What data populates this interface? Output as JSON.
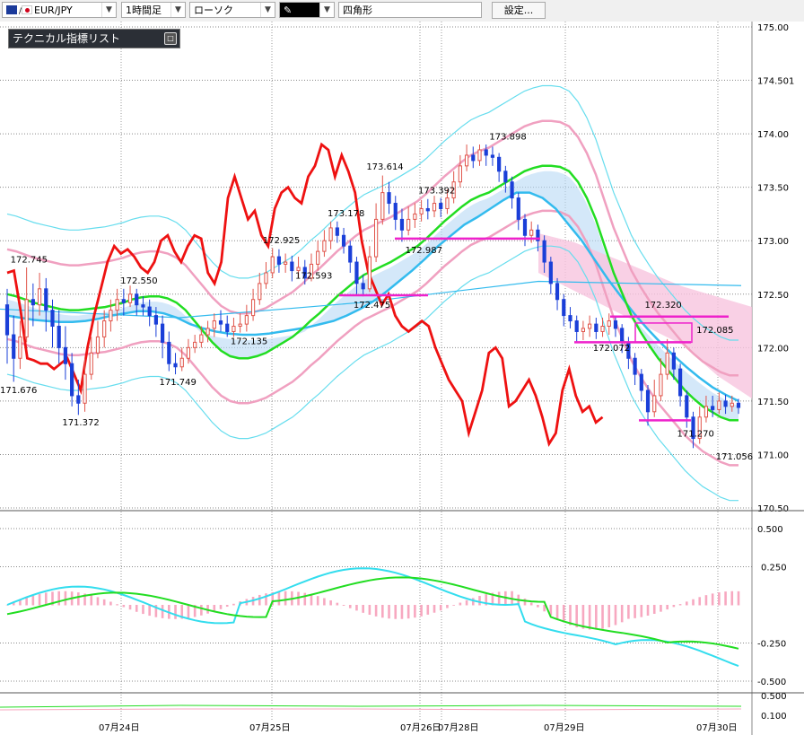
{
  "toolbar": {
    "symbol": "EUR/JPY",
    "timeframe": "1時間足",
    "chart_style": "ローソク",
    "draw_tool_icon": "pen-icon",
    "draw_shape": "四角形",
    "settings_label": "設定..."
  },
  "indicator_panel": {
    "title": "テクニカル指標リスト"
  },
  "colors": {
    "candle_up": "#e0544a",
    "candle_down": "#1a3fd8",
    "ma_red": "#ee1111",
    "bb_mid": "#22dd22",
    "bb_inner": "#f0a0c0",
    "bb_outer": "#66ddee",
    "ma_sky": "#33bbee",
    "cloud_fill": "#b7d9f5",
    "cloud_fill_pink": "#f7c4de",
    "magenta": "#ee22cc"
  },
  "chart_data": {
    "type": "candlestick",
    "symbol": "EUR/JPY",
    "y_ticks": [
      "175.00",
      "174.501",
      "174.00",
      "173.50",
      "173.00",
      "172.50",
      "172.00",
      "171.50",
      "171.00",
      "170.50"
    ],
    "ylim": [
      170.5,
      175.0
    ],
    "x_labels": [
      "07月24日",
      "07月25日",
      "07月26日",
      "07月28日",
      "07月29日",
      "07月30日"
    ],
    "price_labels": [
      {
        "text": "172.745",
        "index": 3,
        "price": 172.745
      },
      {
        "text": "171.676",
        "index": 1,
        "price": 171.676
      },
      {
        "text": "171.372",
        "index": 11,
        "price": 171.372
      },
      {
        "text": "172.550",
        "index": 20,
        "price": 172.55
      },
      {
        "text": "171.749",
        "index": 26,
        "price": 171.749
      },
      {
        "text": "172.135",
        "index": 37,
        "price": 172.135
      },
      {
        "text": "172.925",
        "index": 42,
        "price": 172.925
      },
      {
        "text": "172.593",
        "index": 47,
        "price": 172.593
      },
      {
        "text": "173.178",
        "index": 52,
        "price": 173.178
      },
      {
        "text": "172.475",
        "index": 56,
        "price": 172.475
      },
      {
        "text": "173.614",
        "index": 58,
        "price": 173.614
      },
      {
        "text": "173.392",
        "index": 66,
        "price": 173.392
      },
      {
        "text": "172.987",
        "index": 64,
        "price": 172.987
      },
      {
        "text": "173.898",
        "index": 77,
        "price": 173.898
      },
      {
        "text": "172.320",
        "index": 101,
        "price": 172.32
      },
      {
        "text": "172.085",
        "index": 109,
        "price": 172.085
      },
      {
        "text": "172.072",
        "index": 93,
        "price": 172.072
      },
      {
        "text": "171.270",
        "index": 106,
        "price": 171.27
      },
      {
        "text": "171.056",
        "index": 112,
        "price": 171.056
      }
    ],
    "candles": [
      [
        172.4,
        172.12,
        172.55,
        171.85
      ],
      [
        172.12,
        171.9,
        172.3,
        171.68
      ],
      [
        171.9,
        172.1,
        172.25,
        171.8
      ],
      [
        172.1,
        172.45,
        172.75,
        172.05
      ],
      [
        172.45,
        172.4,
        172.6,
        172.2
      ],
      [
        172.4,
        172.55,
        172.7,
        172.3
      ],
      [
        172.55,
        172.35,
        172.65,
        172.15
      ],
      [
        172.35,
        172.2,
        172.45,
        172.0
      ],
      [
        172.2,
        172.0,
        172.35,
        171.85
      ],
      [
        172.0,
        171.85,
        172.2,
        171.7
      ],
      [
        171.85,
        171.55,
        171.95,
        171.45
      ],
      [
        171.55,
        171.48,
        171.7,
        171.37
      ],
      [
        171.48,
        171.75,
        171.9,
        171.4
      ],
      [
        171.75,
        171.95,
        172.1,
        171.7
      ],
      [
        171.95,
        172.1,
        172.25,
        171.9
      ],
      [
        172.1,
        172.25,
        172.35,
        172.0
      ],
      [
        172.25,
        172.35,
        172.45,
        172.15
      ],
      [
        172.35,
        172.45,
        172.55,
        172.25
      ],
      [
        172.45,
        172.42,
        172.55,
        172.3
      ],
      [
        172.42,
        172.5,
        172.58,
        172.38
      ],
      [
        172.5,
        172.4,
        172.55,
        172.3
      ],
      [
        172.4,
        172.38,
        172.48,
        172.3
      ],
      [
        172.38,
        172.3,
        172.45,
        172.2
      ],
      [
        172.3,
        172.22,
        172.38,
        172.1
      ],
      [
        172.22,
        172.05,
        172.3,
        171.9
      ],
      [
        172.05,
        171.85,
        172.15,
        171.78
      ],
      [
        171.85,
        171.82,
        171.95,
        171.75
      ],
      [
        171.82,
        171.9,
        172.0,
        171.78
      ],
      [
        171.9,
        172.0,
        172.08,
        171.85
      ],
      [
        172.0,
        172.05,
        172.12,
        171.95
      ],
      [
        172.05,
        172.12,
        172.2,
        172.0
      ],
      [
        172.12,
        172.18,
        172.25,
        172.05
      ],
      [
        172.18,
        172.25,
        172.32,
        172.1
      ],
      [
        172.25,
        172.22,
        172.35,
        172.15
      ],
      [
        172.22,
        172.15,
        172.3,
        172.1
      ],
      [
        172.15,
        172.2,
        172.28,
        172.1
      ],
      [
        172.2,
        172.22,
        172.32,
        172.14
      ],
      [
        172.22,
        172.3,
        172.4,
        172.15
      ],
      [
        172.3,
        172.45,
        172.55,
        172.25
      ],
      [
        172.45,
        172.6,
        172.7,
        172.4
      ],
      [
        172.6,
        172.7,
        172.8,
        172.55
      ],
      [
        172.7,
        172.85,
        172.93,
        172.65
      ],
      [
        172.85,
        172.78,
        172.92,
        172.7
      ],
      [
        172.78,
        172.8,
        172.88,
        172.7
      ],
      [
        172.8,
        172.72,
        172.86,
        172.62
      ],
      [
        172.72,
        172.75,
        172.85,
        172.65
      ],
      [
        172.75,
        172.65,
        172.82,
        172.59
      ],
      [
        172.65,
        172.78,
        172.88,
        172.62
      ],
      [
        172.78,
        172.9,
        173.0,
        172.72
      ],
      [
        172.9,
        173.0,
        173.1,
        172.85
      ],
      [
        173.0,
        173.12,
        173.18,
        172.92
      ],
      [
        173.12,
        173.05,
        173.18,
        172.98
      ],
      [
        173.05,
        172.95,
        173.12,
        172.88
      ],
      [
        172.95,
        172.8,
        173.0,
        172.7
      ],
      [
        172.8,
        172.6,
        172.85,
        172.5
      ],
      [
        172.6,
        172.55,
        172.68,
        172.48
      ],
      [
        172.55,
        172.85,
        172.95,
        172.52
      ],
      [
        172.85,
        173.2,
        173.35,
        172.8
      ],
      [
        173.2,
        173.45,
        173.61,
        173.15
      ],
      [
        173.45,
        173.35,
        173.55,
        173.25
      ],
      [
        173.35,
        173.2,
        173.42,
        173.1
      ],
      [
        173.2,
        173.1,
        173.3,
        172.99
      ],
      [
        173.1,
        173.2,
        173.32,
        173.05
      ],
      [
        173.2,
        173.25,
        173.35,
        173.12
      ],
      [
        173.25,
        173.3,
        173.38,
        173.18
      ],
      [
        173.3,
        173.28,
        173.39,
        173.2
      ],
      [
        173.28,
        173.35,
        173.42,
        173.22
      ],
      [
        173.35,
        173.3,
        173.4,
        173.22
      ],
      [
        173.3,
        173.4,
        173.48,
        173.25
      ],
      [
        173.4,
        173.55,
        173.65,
        173.35
      ],
      [
        173.55,
        173.7,
        173.8,
        173.5
      ],
      [
        173.7,
        173.8,
        173.9,
        173.65
      ],
      [
        173.8,
        173.75,
        173.88,
        173.68
      ],
      [
        173.75,
        173.85,
        173.9,
        173.7
      ],
      [
        173.85,
        173.8,
        173.9,
        173.7
      ],
      [
        173.8,
        173.78,
        173.88,
        173.7
      ],
      [
        173.78,
        173.65,
        173.82,
        173.55
      ],
      [
        173.65,
        173.55,
        173.7,
        173.45
      ],
      [
        173.55,
        173.4,
        173.6,
        173.3
      ],
      [
        173.4,
        173.2,
        173.45,
        173.1
      ],
      [
        173.2,
        173.05,
        173.25,
        172.95
      ],
      [
        173.05,
        173.1,
        173.18,
        172.98
      ],
      [
        173.1,
        173.0,
        173.15,
        172.9
      ],
      [
        173.0,
        172.8,
        173.05,
        172.7
      ],
      [
        172.8,
        172.6,
        172.85,
        172.5
      ],
      [
        172.6,
        172.45,
        172.65,
        172.35
      ],
      [
        172.45,
        172.3,
        172.5,
        172.2
      ],
      [
        172.3,
        172.25,
        172.38,
        172.18
      ],
      [
        172.25,
        172.15,
        172.3,
        172.05
      ],
      [
        172.15,
        172.18,
        172.25,
        172.07
      ],
      [
        172.18,
        172.22,
        172.3,
        172.1
      ],
      [
        172.22,
        172.15,
        172.28,
        172.08
      ],
      [
        172.15,
        172.2,
        172.28,
        172.1
      ],
      [
        172.2,
        172.25,
        172.32,
        172.12
      ],
      [
        172.25,
        172.18,
        172.3,
        172.1
      ],
      [
        172.18,
        172.05,
        172.22,
        171.95
      ],
      [
        172.05,
        171.9,
        172.1,
        171.8
      ],
      [
        171.9,
        171.75,
        171.95,
        171.65
      ],
      [
        171.75,
        171.6,
        171.8,
        171.5
      ],
      [
        171.6,
        171.4,
        171.65,
        171.27
      ],
      [
        171.4,
        171.55,
        171.7,
        171.35
      ],
      [
        171.55,
        171.75,
        171.9,
        171.5
      ],
      [
        171.75,
        171.95,
        172.08,
        171.7
      ],
      [
        171.95,
        171.8,
        172.0,
        171.7
      ],
      [
        171.8,
        171.55,
        171.85,
        171.45
      ],
      [
        171.55,
        171.35,
        171.6,
        171.25
      ],
      [
        171.35,
        171.15,
        171.4,
        171.06
      ],
      [
        171.15,
        171.35,
        171.45,
        171.1
      ],
      [
        171.35,
        171.45,
        171.55,
        171.3
      ],
      [
        171.45,
        171.42,
        171.55,
        171.35
      ],
      [
        171.42,
        171.5,
        171.58,
        171.38
      ],
      [
        171.5,
        171.45,
        171.56,
        171.38
      ],
      [
        171.45,
        171.48,
        171.55,
        171.4
      ],
      [
        171.48,
        171.44,
        171.52,
        171.38
      ]
    ],
    "ma_red": [
      172.7,
      172.72,
      172.35,
      171.9,
      171.88,
      171.85,
      171.85,
      171.8,
      171.85,
      171.9,
      171.75,
      171.6,
      172.0,
      172.3,
      172.55,
      172.8,
      172.95,
      172.88,
      172.92,
      172.85,
      172.75,
      172.7,
      172.8,
      173.0,
      173.05,
      172.9,
      172.8,
      172.95,
      173.05,
      173.02,
      172.7,
      172.6,
      172.8,
      173.4,
      173.6,
      173.4,
      173.2,
      173.28,
      173.05,
      172.95,
      173.3,
      173.45,
      173.5,
      173.4,
      173.35,
      173.6,
      173.7,
      173.9,
      173.85,
      173.6,
      173.8,
      173.65,
      173.45,
      173.0,
      172.7,
      172.55,
      172.4,
      172.5,
      172.3,
      172.2,
      172.15,
      172.2,
      172.25,
      172.2,
      172.0,
      171.85,
      171.7,
      171.6,
      171.5,
      171.2,
      171.4,
      171.6,
      171.95,
      172.0,
      171.9,
      171.45,
      171.5,
      171.6,
      171.7,
      171.55,
      171.35,
      171.1,
      171.2,
      171.6,
      171.8,
      171.55,
      171.4,
      171.45,
      171.3,
      171.35
    ],
    "bb_mid": [
      172.5,
      172.48,
      172.45,
      172.42,
      172.4,
      172.38,
      172.36,
      172.35,
      172.35,
      172.36,
      172.37,
      172.38,
      172.4,
      172.42,
      172.45,
      172.47,
      172.48,
      172.48,
      172.46,
      172.42,
      172.35,
      172.25,
      172.15,
      172.05,
      171.97,
      171.92,
      171.9,
      171.9,
      171.92,
      171.95,
      172.0,
      172.05,
      172.1,
      172.17,
      172.25,
      172.32,
      172.4,
      172.48,
      172.55,
      172.62,
      172.68,
      172.72,
      172.76,
      172.8,
      172.85,
      172.9,
      172.95,
      173.02,
      173.1,
      173.18,
      173.25,
      173.32,
      173.38,
      173.42,
      173.45,
      173.5,
      173.55,
      173.6,
      173.65,
      173.68,
      173.7,
      173.7,
      173.69,
      173.65,
      173.55,
      173.4,
      173.2,
      172.95,
      172.7,
      172.5,
      172.3,
      172.15,
      172.02,
      171.9,
      171.8,
      171.7,
      171.6,
      171.52,
      171.45,
      171.4,
      171.35,
      171.32,
      171.32
    ],
    "sky_ma": [
      172.3,
      172.28,
      172.26,
      172.25,
      172.24,
      172.24,
      172.25,
      172.27,
      172.3,
      172.32,
      172.34,
      172.34,
      172.32,
      172.28,
      172.22,
      172.18,
      172.15,
      172.13,
      172.12,
      172.12,
      172.13,
      172.15,
      172.17,
      172.19,
      172.22,
      172.25,
      172.3,
      172.36,
      172.43,
      172.52,
      172.62,
      172.72,
      172.83,
      172.95,
      173.05,
      173.15,
      173.22,
      173.3,
      173.38,
      173.45,
      173.45,
      173.4,
      173.3,
      173.15,
      173.0,
      172.82,
      172.64,
      172.48,
      172.32,
      172.18,
      172.05,
      171.93,
      171.82,
      171.72,
      171.63,
      171.56,
      171.5
    ],
    "macd_labels": [
      "0.500",
      "0.250",
      "-0.250",
      "-0.500",
      "0.500",
      "0.100"
    ]
  }
}
